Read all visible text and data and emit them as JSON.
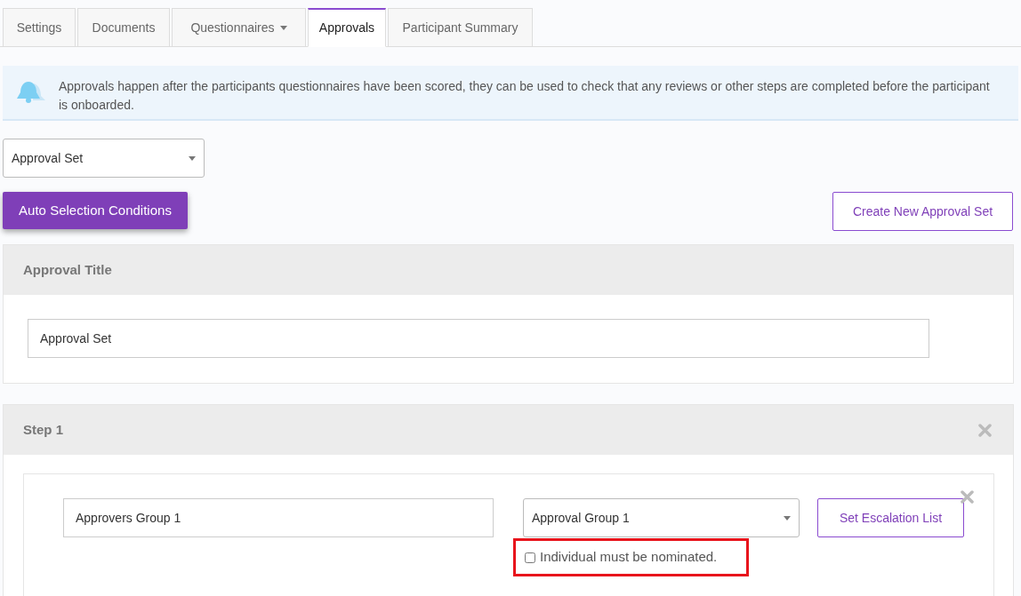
{
  "tabs": [
    {
      "label": "Settings",
      "selected": false,
      "dropdown": false
    },
    {
      "label": "Documents",
      "selected": false,
      "dropdown": false
    },
    {
      "label": "Questionnaires",
      "selected": false,
      "dropdown": true
    },
    {
      "label": "Approvals",
      "selected": true,
      "dropdown": false
    },
    {
      "label": "Participant Summary",
      "selected": false,
      "dropdown": false
    }
  ],
  "info_banner": {
    "text": "Approvals happen after the participants questionnaires have been scored, they can be used to check that any reviews or other steps are completed before the participant is onboarded."
  },
  "approval_set_select": {
    "value": "Approval Set"
  },
  "auto_selection_button": "Auto Selection Conditions",
  "create_button": "Create New Approval Set",
  "title_panel": {
    "heading": "Approval Title",
    "value": "Approval Set"
  },
  "steps": [
    {
      "heading": "Step 1",
      "approvers": [
        {
          "name": "Approvers Group 1",
          "group": "Approval Group 1",
          "escalation_button": "Set Escalation List",
          "checkbox": {
            "label": "Individual must be nominated.",
            "checked": false,
            "highlighted": true
          }
        }
      ]
    }
  ]
}
